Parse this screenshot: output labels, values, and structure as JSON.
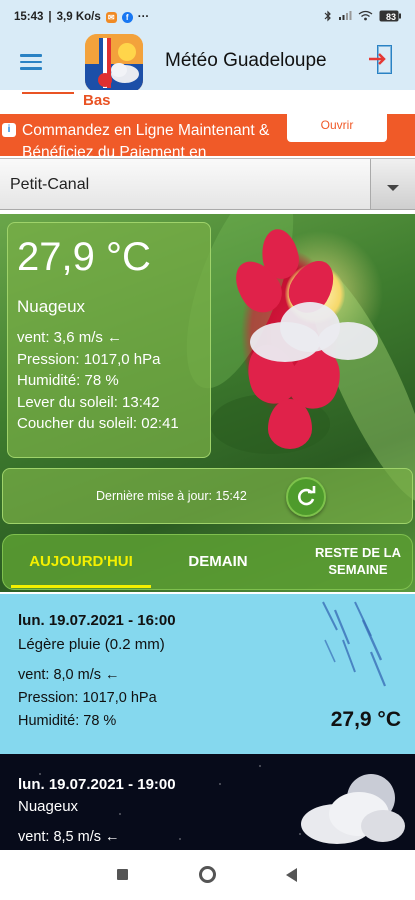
{
  "status_bar": {
    "time": "15:43",
    "speed": "3,9 Ko/s",
    "more": "···",
    "battery": "83",
    "battery_icon": "battery-icon",
    "icons": [
      "notification-icon",
      "facebook-icon",
      "bluetooth-icon",
      "signal-icon",
      "wifi-icon"
    ]
  },
  "header": {
    "title": "Météo Guadeloupe",
    "menu_icon": "hamburger-icon",
    "exit_icon": "exit-icon"
  },
  "ad": {
    "top_text": "Bas",
    "text": "Commandez en Ligne Maintenant & Bénéficiez du Paiement en",
    "button": "Ouvrir",
    "info_icon": "ad-info-icon"
  },
  "location": {
    "selected": "Petit-Canal"
  },
  "current": {
    "temperature": "27,9 °C",
    "condition": "Nuageux",
    "wind": "vent: 3,6 m/s ←",
    "pressure": "Pression: 1017,0 hPa",
    "humidity": "Humidité: 78 %",
    "sunrise": "Lever du soleil: 13:42",
    "sunset": "Coucher du soleil: 02:41"
  },
  "update": {
    "label": "Dernière mise à jour: 15:42"
  },
  "tabs": {
    "today": "AUJOURD'HUI",
    "tomorrow": "DEMAIN",
    "rest_line1": "RESTE DE LA",
    "rest_line2": "SEMAINE"
  },
  "forecast": [
    {
      "datetime": "lun. 19.07.2021 - 16:00",
      "condition": "Légère pluie (0.2 mm)",
      "wind": "vent: 8,0 m/s ←",
      "pressure": "Pression: 1017,0 hPa",
      "humidity": "Humidité: 78 %",
      "temperature": "27,9 °C"
    },
    {
      "datetime": "lun. 19.07.2021 - 19:00",
      "condition": "Nuageux",
      "wind": "vent: 8,5 m/s ←"
    }
  ],
  "colors": {
    "appbar": "#d9ebf7",
    "ad": "#f05a28",
    "panel_green": "#78af46",
    "tab_active": "#f4f000",
    "card_day": "#85d8ee",
    "card_night": "#070b1a"
  }
}
